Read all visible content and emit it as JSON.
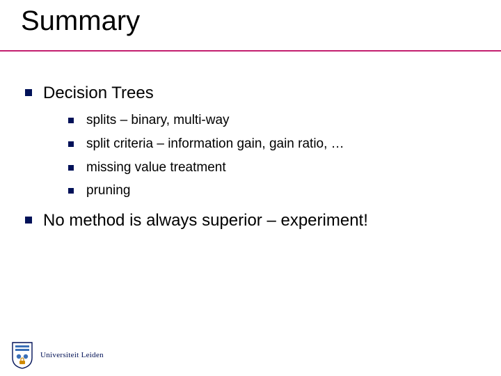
{
  "title": "Summary",
  "bullets": {
    "b1": "Decision Trees",
    "b1_sub": {
      "s1": "splits – binary, multi-way",
      "s2": "split criteria – information gain, gain ratio, …",
      "s3": "missing value treatment",
      "s4": "pruning"
    },
    "b2": "No method is always superior – experiment!"
  },
  "footer": {
    "university": "Universiteit Leiden",
    "shadow": "Universiteit Leiden"
  },
  "colors": {
    "accent": "#c31e6e",
    "brand": "#001158"
  }
}
